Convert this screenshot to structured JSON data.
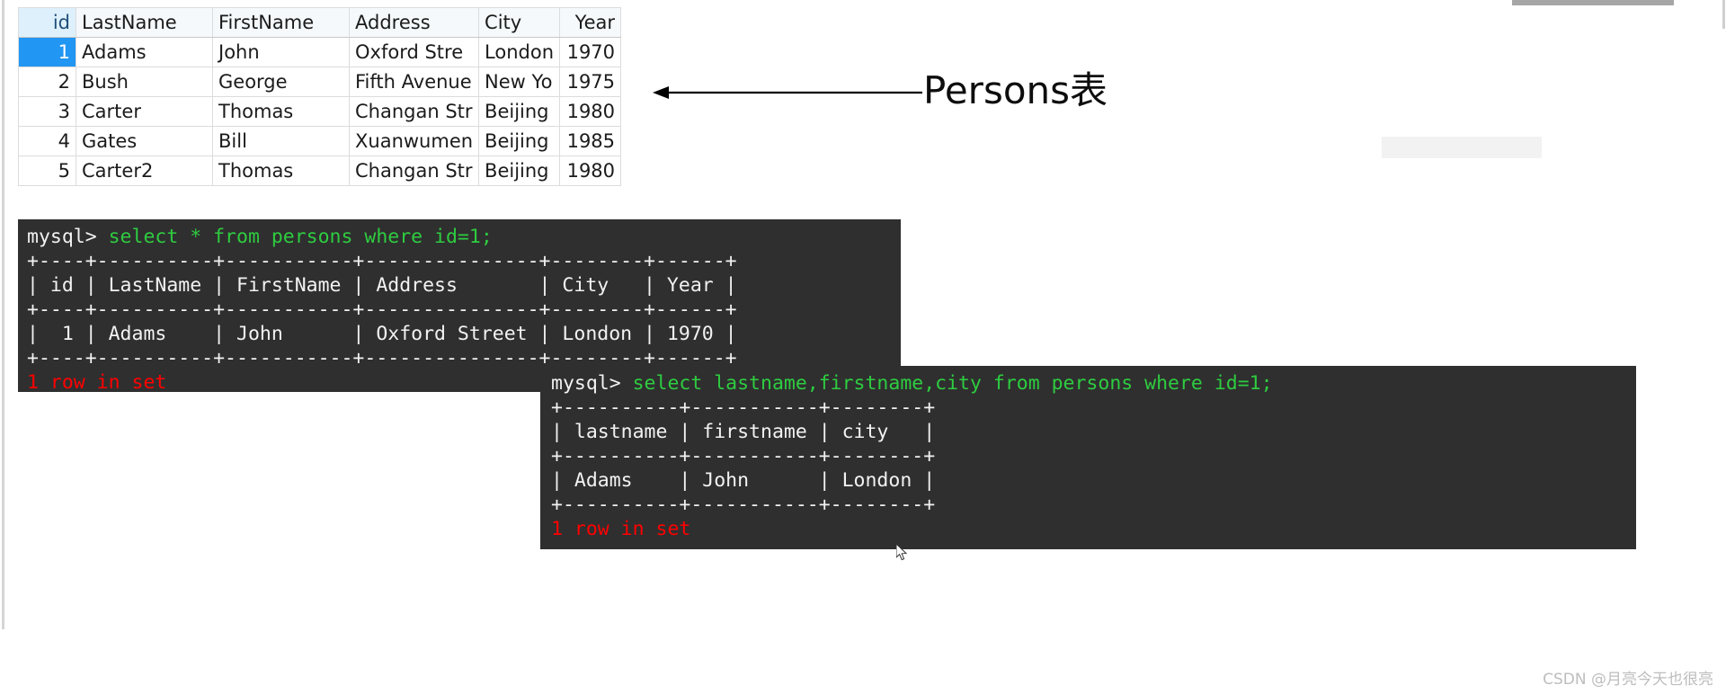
{
  "spreadsheet": {
    "columns": [
      "id",
      "LastName",
      "FirstName",
      "Address",
      "City",
      "Year"
    ],
    "rows": [
      {
        "id": "1",
        "last": "Adams",
        "first": "John",
        "address": "Oxford Stre",
        "city": "London",
        "year": "1970",
        "selected": true
      },
      {
        "id": "2",
        "last": "Bush",
        "first": "George",
        "address": "Fifth Avenue",
        "city": "New Yo",
        "year": "1975",
        "selected": false
      },
      {
        "id": "3",
        "last": "Carter",
        "first": "Thomas",
        "address": "Changan Str",
        "city": "Beijing",
        "year": "1980",
        "selected": false
      },
      {
        "id": "4",
        "last": "Gates",
        "first": "Bill",
        "address": "Xuanwumen",
        "city": "Beijing",
        "year": "1985",
        "selected": false
      },
      {
        "id": "5",
        "last": "Carter2",
        "first": "Thomas",
        "address": "Changan Str",
        "city": "Beijing",
        "year": "1980",
        "selected": false
      }
    ]
  },
  "annotation": {
    "label": "Persons表",
    "arrow_direction": "left"
  },
  "terminal_one": {
    "prompt": "mysql> ",
    "command": "select * from persons where id=1;",
    "lines": [
      "+----+----------+-----------+---------------+--------+------+",
      "| id | LastName | FirstName | Address       | City   | Year |",
      "+----+----------+-----------+---------------+--------+------+",
      "|  1 | Adams    | John      | Oxford Street | London | 1970 |",
      "+----+----------+-----------+---------------+--------+------+"
    ],
    "status": "1 row in set"
  },
  "terminal_two": {
    "prompt": "mysql> ",
    "command": "select lastname,firstname,city from persons where id=1;",
    "lines": [
      "+----------+-----------+--------+",
      "| lastname | firstname | city   |",
      "+----------+-----------+--------+",
      "| Adams    | John      | London |",
      "+----------+-----------+--------+"
    ],
    "status": "1 row in set"
  },
  "watermark": {
    "text": "CSDN @月亮今天也很亮"
  },
  "colors": {
    "terminal_bg": "#2f2f2f",
    "sql_green": "#2ecc40",
    "status_red": "#ff0000",
    "selection_blue": "#2196f3",
    "header_blue": "#def0fb"
  }
}
